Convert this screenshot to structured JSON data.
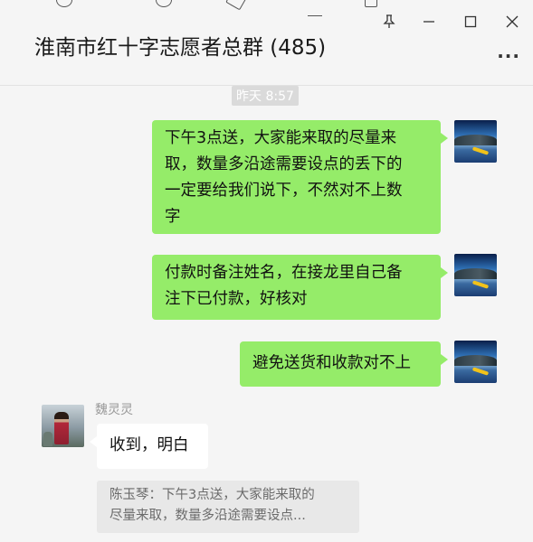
{
  "header": {
    "title": "淮南市红十字志愿者总群 (485)",
    "pin_icon": "pin-icon",
    "minimize_icon": "minimize-icon",
    "maximize_icon": "maximize-icon",
    "close_icon": "close-icon",
    "more_icon": "more-icon",
    "more_label": "···"
  },
  "chat": {
    "timestamp": "昨天 8:57",
    "messages": [
      {
        "from": "me",
        "lines": [
          "下午3点送，大家能来取的尽量来",
          "取，数量多沿途需要设点的丢下的",
          "一定要给我们说下，不然对不上数",
          "字"
        ]
      },
      {
        "from": "me",
        "lines": [
          "付款时备注姓名，在接龙里自己备",
          "注下已付款，好核对"
        ]
      },
      {
        "from": "me",
        "lines": [
          "避免送货和收款对不上"
        ]
      },
      {
        "from": "other",
        "sender": "魏灵灵",
        "lines": [
          "收到，明白"
        ]
      }
    ],
    "quote": {
      "lines": [
        "陈玉琴：下午3点送，大家能来取的",
        "尽量来取，数量多沿途需要设点..."
      ]
    }
  },
  "colors": {
    "my_bubble": "#95ec69",
    "other_bubble": "#ffffff",
    "background": "#f5f5f5"
  }
}
